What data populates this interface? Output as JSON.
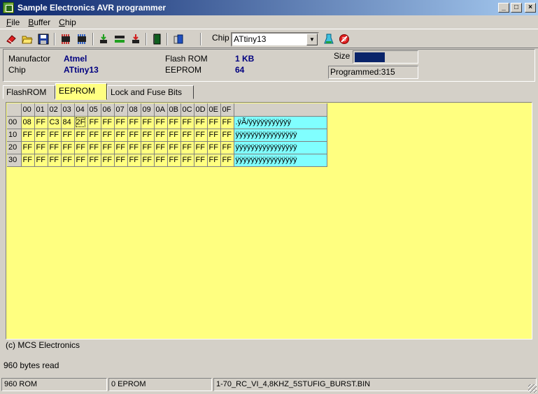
{
  "window": {
    "title": "Sample Electronics AVR programmer",
    "controls": {
      "minimize": "_",
      "maximize": "□",
      "close": "×"
    }
  },
  "menu": [
    {
      "label": "File",
      "mnemonic": "F",
      "rest": "ile"
    },
    {
      "label": "Buffer",
      "mnemonic": "B",
      "rest": "uffer"
    },
    {
      "label": "Chip",
      "mnemonic": "C",
      "rest": "hip"
    }
  ],
  "toolbar": {
    "chip_label": "Chip",
    "chip_value": "ATtiny13",
    "icons": [
      "eraser-icon",
      "open-folder-icon",
      "save-icon",
      "chip-read-icon",
      "chip-write-icon",
      "program-flash-icon",
      "verify-icon",
      "erase-chip-icon",
      "book-icon",
      "lock-bits-icon",
      "auto-program-icon",
      "stop-icon"
    ]
  },
  "info": {
    "manufacturer_label": "Manufactor",
    "manufacturer_value": "Atmel",
    "chip_label": "Chip",
    "chip_value": "ATtiny13",
    "flash_label": "Flash ROM",
    "flash_value": "1 KB",
    "eeprom_label": "EEPROM",
    "eeprom_value": "64",
    "size_label": "Size",
    "size_fraction": 0.48,
    "programmed_text": "Programmed:315"
  },
  "tabs": [
    {
      "label": "FlashROM",
      "active": false
    },
    {
      "label": "EEPROM",
      "active": true
    },
    {
      "label": "Lock and Fuse Bits",
      "active": false
    }
  ],
  "hex": {
    "columns": [
      "00",
      "01",
      "02",
      "03",
      "04",
      "05",
      "06",
      "07",
      "08",
      "09",
      "0A",
      "0B",
      "0C",
      "0D",
      "0E",
      "0F"
    ],
    "rows": [
      {
        "addr": "00",
        "bytes": [
          "08",
          "FF",
          "C3",
          "84",
          "2F",
          "FF",
          "FF",
          "FF",
          "FF",
          "FF",
          "FF",
          "FF",
          "FF",
          "FF",
          "FF",
          "FF"
        ],
        "ascii": ".ÿÃ/ÿÿÿÿÿÿÿÿÿÿÿ"
      },
      {
        "addr": "10",
        "bytes": [
          "FF",
          "FF",
          "FF",
          "FF",
          "FF",
          "FF",
          "FF",
          "FF",
          "FF",
          "FF",
          "FF",
          "FF",
          "FF",
          "FF",
          "FF",
          "FF"
        ],
        "ascii": "ÿÿÿÿÿÿÿÿÿÿÿÿÿÿÿÿ"
      },
      {
        "addr": "20",
        "bytes": [
          "FF",
          "FF",
          "FF",
          "FF",
          "FF",
          "FF",
          "FF",
          "FF",
          "FF",
          "FF",
          "FF",
          "FF",
          "FF",
          "FF",
          "FF",
          "FF"
        ],
        "ascii": "ÿÿÿÿÿÿÿÿÿÿÿÿÿÿÿÿ"
      },
      {
        "addr": "30",
        "bytes": [
          "FF",
          "FF",
          "FF",
          "FF",
          "FF",
          "FF",
          "FF",
          "FF",
          "FF",
          "FF",
          "FF",
          "FF",
          "FF",
          "FF",
          "FF",
          "FF"
        ],
        "ascii": "ÿÿÿÿÿÿÿÿÿÿÿÿÿÿÿÿ"
      }
    ],
    "selected": {
      "row": 0,
      "col": 4
    }
  },
  "copyright": "(c) MCS Electronics",
  "status_message": "960 bytes read",
  "statusbar": [
    "960 ROM",
    "0 EPROM",
    "1-70_RC_VI_4,8KHZ_5STUFIG_BURST.BIN"
  ],
  "colors": {
    "grid_bg": "#ffff80",
    "ascii_bg": "#80ffff",
    "title_start": "#0a246a",
    "value_text": "#000080"
  }
}
